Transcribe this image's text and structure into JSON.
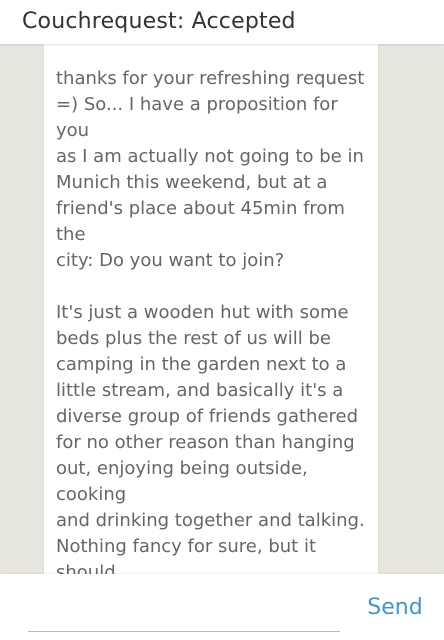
{
  "app": {
    "title": "Couchrequest: Accepted"
  },
  "message": {
    "paragraphs": [
      "thanks for your refreshing request\n=) So... I have a proposition for you\nas I am actually not going to be in\nMunich this weekend, but at a\nfriend's place about 45min from the\ncity: Do you want to join?",
      "It's just a wooden hut with some\nbeds plus the rest of us will be\ncamping in the garden next to a\nlittle stream, and basically it's a\ndiverse group of friends gathered\nfor no other reason than hanging\nout, enjoying being outside, cooking\nand drinking together and talking.\nNothing fancy for sure, but it should\nbe pretty relaxed. Transport,\ncamping stuff etc is basically\nalready taken care of."
    ]
  },
  "compose": {
    "input_value": "",
    "send_label": "Send"
  },
  "colors": {
    "accent": "#3d97d1",
    "background": "#e8e7df",
    "card": "#ffffff",
    "body_text": "#666666",
    "title_text": "#333333"
  }
}
